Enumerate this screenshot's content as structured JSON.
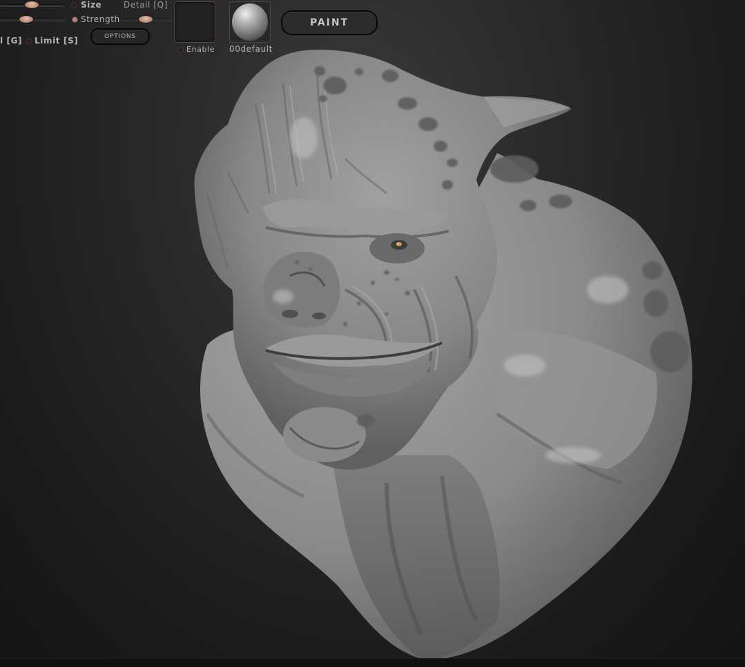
{
  "toolbar": {
    "size_label": "Size",
    "detail_label": "Detail [Q]",
    "strength_label": "Strength",
    "left_g_label": "l [G]",
    "limit_label": "Limit [S]",
    "options_label": "OPTIONS",
    "enable_label": "Enable",
    "material_label": "00default",
    "paint_label": "PAINT"
  },
  "viewport": {
    "background_color": "#1a1a1a",
    "mesh_color": "#8c8c8c",
    "spot_color": "#5d5d5d",
    "eye_color": "#d89a4a"
  }
}
